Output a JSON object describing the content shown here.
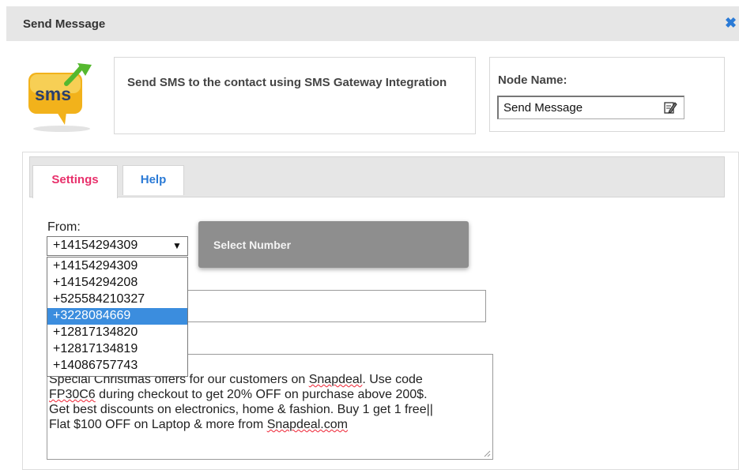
{
  "dialog": {
    "title": "Send Message",
    "close_icon": "close-icon"
  },
  "header": {
    "icon_text": "sms",
    "description": "Send SMS to the contact using SMS Gateway Integration",
    "node_name_label": "Node Name:",
    "node_name_value": "Send Message"
  },
  "tabs": [
    {
      "label": "Settings",
      "active": true
    },
    {
      "label": "Help",
      "active": false
    }
  ],
  "form": {
    "from_label": "From:",
    "from_selected": "+14154294309",
    "select_number_label": "Select Number",
    "from_options": [
      "+14154294309",
      "+14154294208",
      "+525584210327",
      "+3228084669",
      "+12817134820",
      "+12817134819",
      "+14086757743"
    ],
    "highlighted_option": "+3228084669",
    "message_lines": [
      [
        "Special Christmas offers for our customers on ",
        "Snapdeal",
        ". Use code"
      ],
      [
        "FP30C6",
        " during checkout to get 20% OFF on purchase above 200$."
      ],
      [
        "Get best discounts on electronics, home & fashion. Buy 1 get 1 free||"
      ],
      [
        "Flat $100 OFF on Laptop & more from ",
        "Snapdeal.com"
      ]
    ]
  },
  "colors": {
    "accent_blue": "#2a7ad6",
    "active_tab": "#e8306b",
    "highlight": "#3b8dde",
    "select_number_bg": "#8e8e8e"
  }
}
